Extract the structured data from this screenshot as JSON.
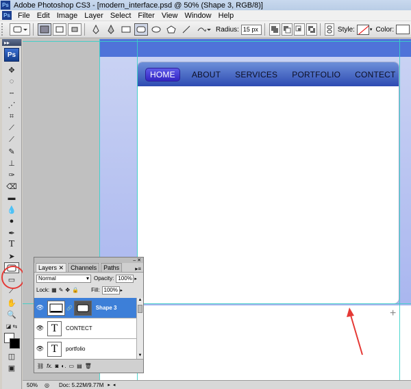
{
  "window": {
    "app_icon": "Ps",
    "title": "Adobe Photoshop CS3 - [modern_interface.psd @ 50% (Shape 3, RGB/8)]"
  },
  "menu": [
    "File",
    "Edit",
    "Image",
    "Layer",
    "Select",
    "Filter",
    "View",
    "Window",
    "Help"
  ],
  "options": {
    "radius_label": "Radius:",
    "radius_value": "15 px",
    "style_label": "Style:",
    "color_label": "Color:",
    "color_value": "#ffffff"
  },
  "tools": {
    "logo": "Ps",
    "selected_tool": "rounded-rectangle-tool",
    "text_tool_glyph": "T"
  },
  "canvas": {
    "nav": [
      "HOME",
      "ABOUT",
      "SERVICES",
      "PORTFOLIO",
      "CONTECT"
    ],
    "active_nav": "HOME",
    "colors": {
      "top_band": "#4f73d9",
      "nav_gradient_top": "#6d8fd9",
      "nav_gradient_bottom": "#2d4bb2",
      "home_button": "#4c3fd6",
      "guide": "#39d0c8",
      "annotation": "#e53935"
    }
  },
  "layers": {
    "tabs": [
      "Layers",
      "Channels",
      "Paths"
    ],
    "blend_mode": "Normal",
    "opacity_label": "Opacity:",
    "opacity_value": "100%",
    "lock_label": "Lock:",
    "fill_label": "Fill:",
    "fill_value": "100%",
    "items": [
      {
        "name": "Shape 3",
        "selected": true
      },
      {
        "name": "CONTECT",
        "selected": false
      },
      {
        "name": "portfolio",
        "selected": false
      }
    ],
    "text_thumb": "T"
  },
  "status": {
    "zoom": "50%",
    "doc_size": "Doc: 5.22M/9.77M"
  }
}
